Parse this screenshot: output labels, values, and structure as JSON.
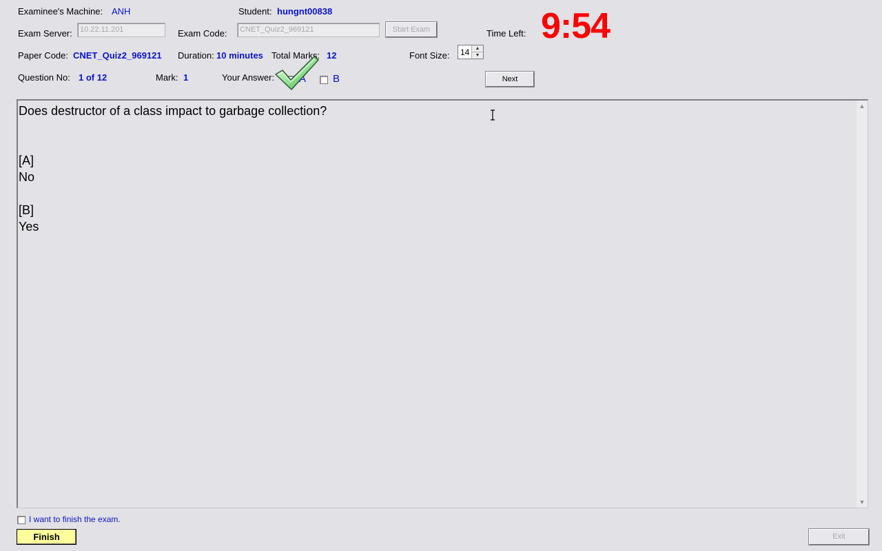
{
  "header": {
    "machine_label": "Examinee's Machine:",
    "machine_value": "ANH",
    "student_label": "Student:",
    "student_value": "hungnt00838",
    "server_label": "Exam Server:",
    "server_value": "10.22.11.201",
    "exam_code_label": "Exam Code:",
    "exam_code_value": "CNET_Quiz2_969121",
    "start_exam_label": "Start Exam",
    "time_left_label": "Time Left:",
    "time_left_value": "9:54",
    "paper_code_label": "Paper Code:",
    "paper_code_value": "CNET_Quiz2_969121",
    "duration_label": "Duration:",
    "duration_value": "10 minutes",
    "total_marks_label": "Total Marks:",
    "total_marks_value": "12",
    "font_size_label": "Font Size:",
    "font_size_value": "14",
    "question_no_label": "Question No:",
    "question_no_value": "1 of 12",
    "mark_label": "Mark:",
    "mark_value": "1",
    "your_answer_label": "Your Answer:",
    "answer_a": "A",
    "answer_b": "B",
    "next_label": "Next"
  },
  "question": {
    "text": "Does destructor of a class impact to garbage collection?",
    "options": [
      {
        "tag": "[A]",
        "text": "No"
      },
      {
        "tag": "[B]",
        "text": "Yes"
      }
    ]
  },
  "footer": {
    "finish_check_label": "I want to finish the exam.",
    "finish_label": "Finish",
    "exit_label": "Exit"
  },
  "colors": {
    "value_blue": "#0a14c8",
    "timer_red": "#ff0000",
    "finish_yellow": "#ffff9c",
    "background": "#e2e1e6"
  }
}
